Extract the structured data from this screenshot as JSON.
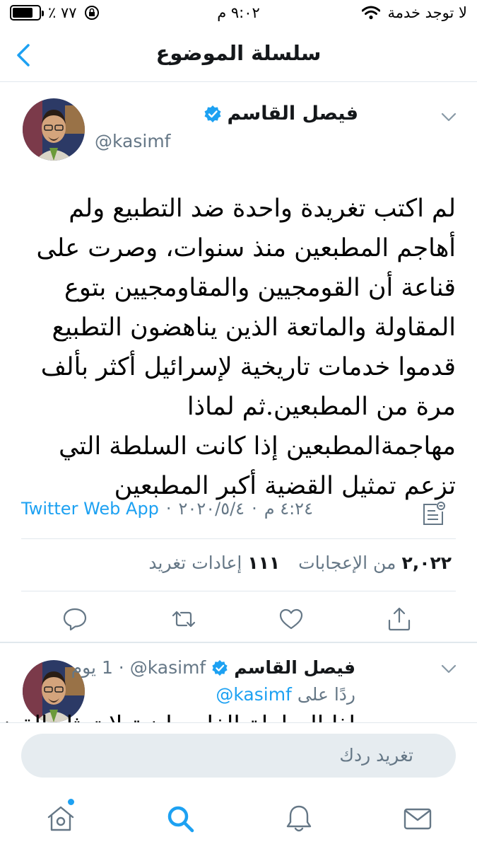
{
  "status_bar": {
    "battery_text": "٪ ٧٧",
    "battery_level": 0.77,
    "time": "٩:٠٢ م",
    "carrier": "لا توجد خدمة"
  },
  "header": {
    "title": "سلسلة الموضوع",
    "back_icon": "chevron-left-icon"
  },
  "tweet": {
    "display_name": "فيصل القاسم",
    "handle": "@kasimf",
    "text": "لم اكتب تغريدة واحدة ضد التطبيع ولم أهاجم المطبعين منذ سنوات، وصرت على قناعة أن القومجيين والمقاومجيين بتوع المقاولة والماتعة الذين يناهضون التطبيع قدموا خدمات تاريخية لإسرائيل أكثر بألف مرة من المطبعين.ثم لماذا مهاجمةالمطبعين إذا كانت السلطة التي تزعم تمثيل القضية أكبر المطبعين",
    "time": "٤:٢٤ م",
    "date": "٢٠٢٠/٥/٤",
    "separator": "·",
    "source": "Twitter Web App",
    "likes_count": "٢,٠٢٢",
    "likes_label": "من الإعجابات",
    "retweets_count": "١١١",
    "retweets_label": "إعادات تغريد"
  },
  "reply_tweet": {
    "display_name": "فيصل القاسم",
    "handle": "@kasimf",
    "time": "· 1 يوم",
    "replying_label": "ردًا على",
    "replying_handle": "@kasimf",
    "snippet": "اذا السلطة الفلسطينية لا تمثل القضية"
  },
  "compose": {
    "placeholder": "تغريد ردك"
  },
  "colors": {
    "accent": "#1da1f2",
    "text_primary": "#14171a",
    "text_secondary": "#657786",
    "divider": "#e1e8ed",
    "compose_bg": "#e6ecf0"
  },
  "icons": {
    "status": [
      "battery-icon",
      "orientation-lock-icon",
      "wifi-icon"
    ],
    "actions": [
      "reply-icon",
      "retweet-icon",
      "like-icon",
      "share-icon"
    ],
    "tabs": [
      "home-icon",
      "search-icon",
      "notifications-icon",
      "messages-icon"
    ]
  }
}
